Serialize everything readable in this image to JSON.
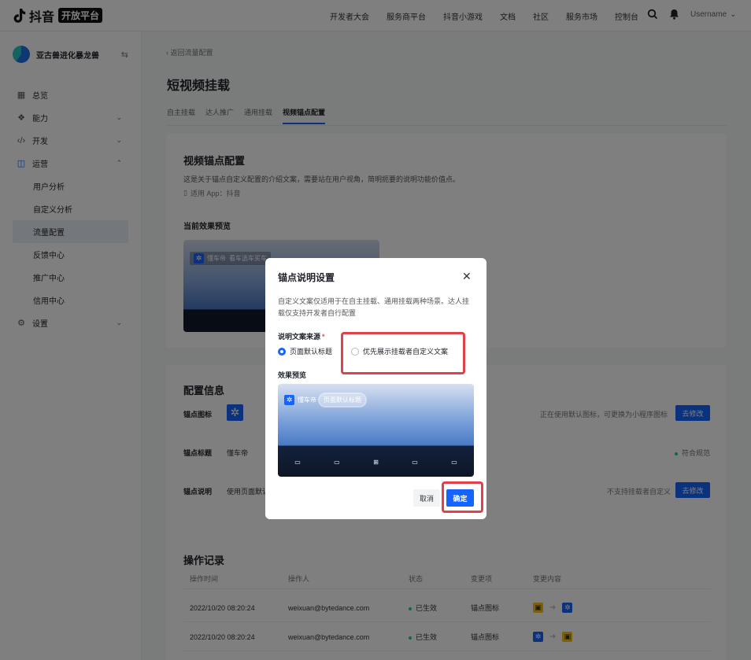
{
  "topbar": {
    "logo_text": "抖音",
    "logo_tag": "开放平台",
    "nav": [
      "开发者大会",
      "服务商平台",
      "抖音小游戏",
      "文档",
      "社区",
      "服务市场",
      "控制台"
    ],
    "username": "Username"
  },
  "sidebar": {
    "workspace": "亚古兽进化暴龙兽",
    "items": [
      {
        "label": "总览",
        "icon": "dashboard-icon"
      },
      {
        "label": "能力",
        "icon": "puzzle-icon"
      },
      {
        "label": "开发",
        "icon": "code-icon"
      },
      {
        "label": "运营",
        "icon": "chart-icon"
      },
      {
        "label": "用户分析"
      },
      {
        "label": "自定义分析"
      },
      {
        "label": "流量配置"
      },
      {
        "label": "反馈中心"
      },
      {
        "label": "推广中心"
      },
      {
        "label": "信用中心"
      },
      {
        "label": "设置",
        "icon": "settings-icon"
      }
    ]
  },
  "main": {
    "back": "返回流量配置",
    "title": "短视频挂载",
    "tabs": [
      "自主挂载",
      "达人推广",
      "通用挂载",
      "视频锚点配置"
    ],
    "active_tab": "视频锚点配置",
    "section1": {
      "title": "视频锚点配置",
      "desc": "这是关于锚点自定义配置的介绍文案，需要站在用户视角，简明扼要的说明功能价值点。",
      "app": "适用 App：抖音",
      "preview_label": "当前效果预览",
      "preview_tag_name": "懂车帝",
      "preview_tag_text": "看车选车买车"
    },
    "section2": {
      "title": "配置信息",
      "rows": [
        {
          "label": "锚点图标",
          "value": "",
          "note": "正在使用默认图标，可更换为小程序图标",
          "button": "去修改"
        },
        {
          "label": "锚点标题",
          "value": "懂车帝",
          "note": "符合规范",
          "button": ""
        },
        {
          "label": "锚点说明",
          "value": "使用页面默认",
          "note": "不支持挂载者自定义",
          "button": "去修改"
        }
      ]
    },
    "section3": {
      "title": "操作记录",
      "headers": [
        "操作时间",
        "操作人",
        "状态",
        "变更项",
        "变更内容"
      ],
      "rows": [
        {
          "time": "2022/10/20 08:20:24",
          "user": "weixuan@bytedance.com",
          "status": "已生效",
          "item": "锚点图标"
        },
        {
          "time": "2022/10/20 08:20:24",
          "user": "weixuan@bytedance.com",
          "status": "已生效",
          "item": "锚点图标"
        }
      ]
    }
  },
  "modal": {
    "title": "锚点说明设置",
    "desc": "自定义文案仅适用于在自主挂载、通用挂载两种场景。达人挂载仅支持开发者自行配置",
    "source_label": "说明文案来源",
    "required_mark": "*",
    "options": [
      "页面默认标题",
      "优先展示挂载者自定义文案"
    ],
    "selected_option": "页面默认标题",
    "preview_label": "效果预览",
    "preview_name": "懂车帝",
    "preview_highlight": "页面默认标题",
    "cancel": "取消",
    "confirm": "确定"
  },
  "colors": {
    "accent": "#1664ff",
    "highlight": "#e0424a",
    "success": "#2bc4a8"
  }
}
